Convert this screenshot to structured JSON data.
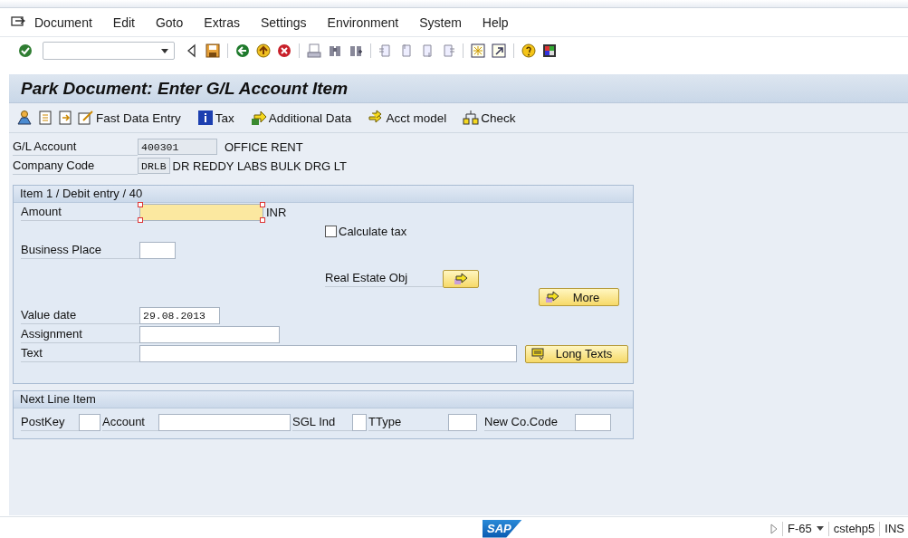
{
  "menu": [
    "Document",
    "Edit",
    "Goto",
    "Extras",
    "Settings",
    "Environment",
    "System",
    "Help"
  ],
  "title": "Park Document: Enter G/L Account Item",
  "app_toolbar": [
    {
      "label": "Fast Data Entry"
    },
    {
      "label": "Tax"
    },
    {
      "label": "Additional Data"
    },
    {
      "label": "Acct model"
    },
    {
      "label": "Check"
    }
  ],
  "header_fields": [
    {
      "label": "G/L Account",
      "value": "400301",
      "description": "OFFICE RENT"
    },
    {
      "label": "Company Code",
      "value": "DRLB",
      "description": "DR REDDY LABS BULK DRG LT"
    }
  ],
  "item_section": {
    "title": "Item 1 / Debit entry / 40",
    "amount": {
      "label": "Amount",
      "focused": true,
      "currency": "INR"
    },
    "calculate_tax": {
      "label": "Calculate tax",
      "checked": false
    },
    "business_place": {
      "label": "Business Place"
    },
    "real_estate_obj": {
      "label": "Real Estate Obj"
    },
    "more_button": {
      "label": "More"
    },
    "value_date": {
      "label": "Value date",
      "value": "29.08.2013"
    },
    "assignment": {
      "label": "Assignment"
    },
    "text": {
      "label": "Text"
    },
    "long_texts_button": {
      "label": "Long Texts"
    }
  },
  "next_line_item": {
    "title": "Next Line Item",
    "fields": [
      {
        "label": "PostKey"
      },
      {
        "label": "Account"
      },
      {
        "label": "SGL Ind"
      },
      {
        "label": "TType"
      },
      {
        "label": "New Co.Code"
      }
    ]
  },
  "status_bar": {
    "logo": "SAP",
    "transaction": "F-65",
    "server": "cstehp5",
    "mode": "INS"
  }
}
